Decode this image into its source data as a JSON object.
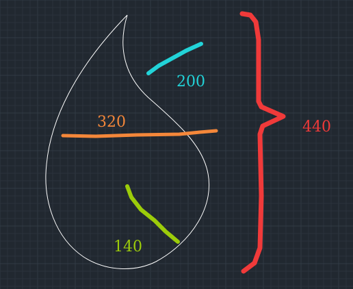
{
  "colors": {
    "background": "#212830",
    "grid_minor": "#2a323c",
    "grid_major": "#313a45",
    "outline": "#ffffff",
    "cyan": "#22d3d8",
    "orange": "#f4873a",
    "green": "#9ccc0a",
    "red": "#f03a3a"
  },
  "shape": {
    "name": "water-drop-outline"
  },
  "dimensions": {
    "cyan": {
      "value": "200"
    },
    "orange": {
      "value": "320"
    },
    "green": {
      "value": "140"
    },
    "red": {
      "value": "440"
    }
  }
}
